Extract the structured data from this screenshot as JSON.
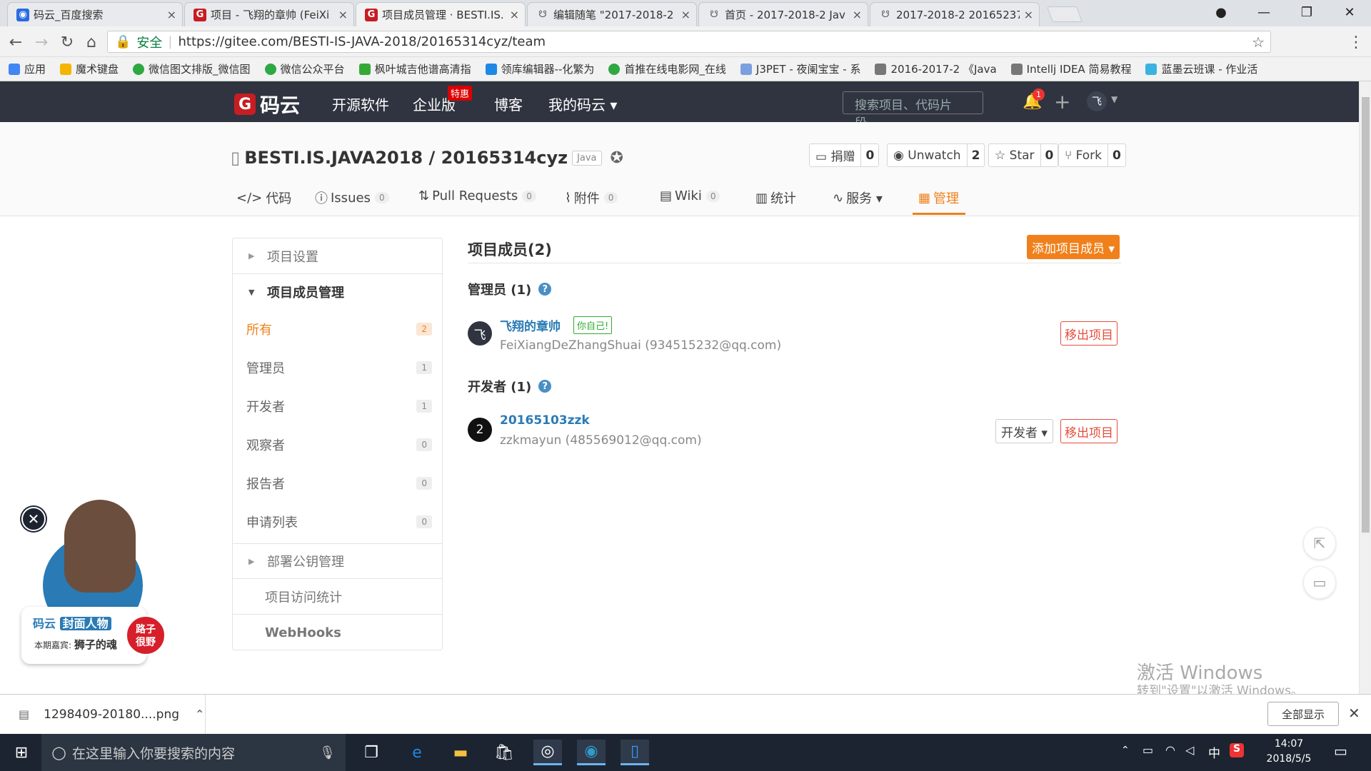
{
  "browser": {
    "tabs": [
      {
        "title": "码云_百度搜索"
      },
      {
        "title": "项目 - 飞翔的章帅 (FeiXi"
      },
      {
        "title": "项目成员管理 · BESTI.IS."
      },
      {
        "title": "编辑随笔 \"2017-2018-2"
      },
      {
        "title": "首页 - 2017-2018-2 Jav"
      },
      {
        "title": "2017-2018-2 20165237"
      }
    ],
    "tab_close": "×",
    "secure_label": "安全",
    "url": "https://gitee.com/BESTI-IS-JAVA-2018/20165314cyz/team",
    "bookmarks": [
      {
        "label": "应用",
        "color": "#4285f4"
      },
      {
        "label": "魔术键盘",
        "color": "#f4b400"
      },
      {
        "label": "微信图文排版_微信图",
        "color": "#2ea843"
      },
      {
        "label": "微信公众平台",
        "color": "#2ea843"
      },
      {
        "label": "枫叶城吉他谱高清指",
        "color": "#36a836"
      },
      {
        "label": "领库编辑器--化繁为",
        "color": "#1e88e5"
      },
      {
        "label": "首推在线电影网_在线",
        "color": "#2ea843"
      },
      {
        "label": "J3PET - 夜阑宝宝 - 系",
        "color": "#7aa0e0"
      },
      {
        "label": "2016-2017-2 《Java",
        "color": "#555"
      },
      {
        "label": "Intellj IDEA 简易教程",
        "color": "#555"
      },
      {
        "label": "蓝墨云班课 - 作业活",
        "color": "#3bb3e0"
      }
    ]
  },
  "site": {
    "logo": "码云",
    "logo_g": "G",
    "nav": [
      "开源软件",
      "企业版",
      "博客",
      "我的码云 ▾"
    ],
    "hot_badge": "特惠",
    "search_placeholder": "搜索项目、代码片段...",
    "notif_count": "1",
    "user_initial": "飞"
  },
  "repo": {
    "owner": "BESTI.IS.JAVA2018",
    "sep": " / ",
    "name": "20165314cyz",
    "lang": "Java",
    "buttons": [
      {
        "label": "捐赠",
        "count": "0"
      },
      {
        "label": "Unwatch",
        "count": "2"
      },
      {
        "label": "Star",
        "count": "0"
      },
      {
        "label": "Fork",
        "count": "0"
      }
    ],
    "tabs": [
      {
        "label": "代码",
        "icon": "</>",
        "badge": ""
      },
      {
        "label": "Issues",
        "icon": "ⓘ",
        "badge": "0"
      },
      {
        "label": "Pull Requests",
        "icon": "⇅",
        "badge": "0"
      },
      {
        "label": "附件",
        "icon": "⌇",
        "badge": "0"
      },
      {
        "label": "Wiki",
        "icon": "▤",
        "badge": "0"
      },
      {
        "label": "统计",
        "icon": "▥",
        "badge": ""
      },
      {
        "label": "服务 ▾",
        "icon": "∿",
        "badge": ""
      },
      {
        "label": "管理",
        "icon": "▦",
        "badge": ""
      }
    ]
  },
  "sidebar": {
    "settings": "项目设置",
    "members": "项目成员管理",
    "items": [
      {
        "label": "所有",
        "count": "2"
      },
      {
        "label": "管理员",
        "count": "1"
      },
      {
        "label": "开发者",
        "count": "1"
      },
      {
        "label": "观察者",
        "count": "0"
      },
      {
        "label": "报告者",
        "count": "0"
      },
      {
        "label": "申请列表",
        "count": "0"
      }
    ],
    "deploy_keys": "部署公钥管理",
    "stats": "项目访问统计",
    "webhooks": "WebHooks"
  },
  "content": {
    "title": "项目成员(2)",
    "add_button": "添加项目成员 ▾",
    "admins_heading": "管理员 (1)",
    "devs_heading": "开发者 (1)",
    "help": "?",
    "admin": {
      "avatar": "飞",
      "name": "飞翔的章帅",
      "badge": "你自己!",
      "email": "FeiXiangDeZhangShuai (934515232@qq.com)",
      "remove": "移出项目"
    },
    "dev": {
      "avatar": "2",
      "name": "20165103zzk",
      "email": "zzkmayun (485569012@qq.com)",
      "role": "开发者 ▾",
      "remove": "移出项目"
    }
  },
  "promo": {
    "brand": "码云",
    "series": "封面人物",
    "tag1": "路子",
    "tag2": "很野",
    "guest_label": "本期嘉宾:",
    "guest": "狮子的魂"
  },
  "watermark": {
    "line1": "激活 Windows",
    "line2": "转到\"设置\"以激活 Windows。"
  },
  "download": {
    "file": "1298409-20180....png",
    "show_all": "全部显示"
  },
  "taskbar": {
    "search": "在这里输入你要搜索的内容",
    "ime": "中",
    "time": "14:07",
    "date": "2018/5/5"
  }
}
